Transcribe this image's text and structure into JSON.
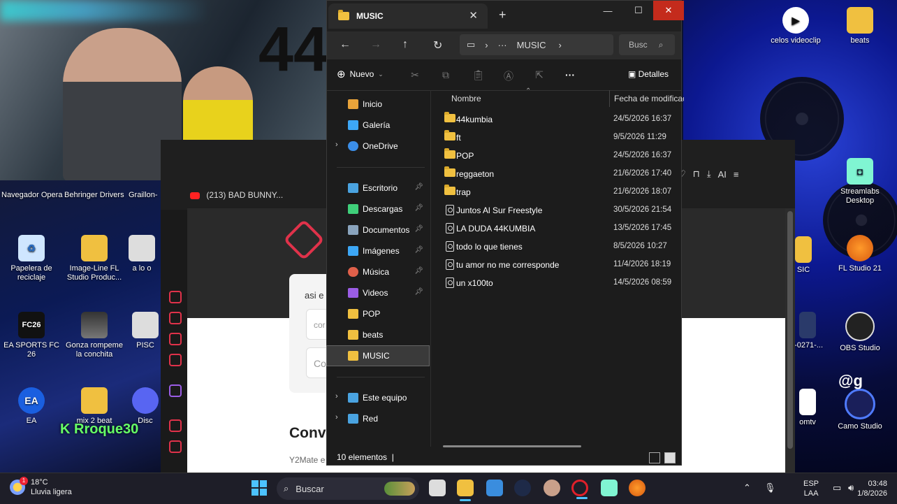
{
  "webcam": {
    "wall_text": "44"
  },
  "desktop": {
    "top_labels": [
      "Navegador Opera",
      "Behringer Drivers",
      "Graillon-"
    ],
    "left_icons": [
      {
        "label": "Papelera de reciclaje",
        "icon": "recycle-bin-icon"
      },
      {
        "label": "Image-Line FL Studio Produc...",
        "icon": "folder-icon"
      },
      {
        "label": "a lo o",
        "icon": "app-icon"
      },
      {
        "label": "EA SPORTS FC 26",
        "icon": "fc26-icon"
      },
      {
        "label": "Gonza rompeme la conchita",
        "icon": "video-icon"
      },
      {
        "label": "PISC",
        "icon": "app-icon"
      },
      {
        "label": "EA",
        "icon": "ea-icon"
      },
      {
        "label": "mix 2 beat",
        "icon": "folder-icon"
      },
      {
        "label": "Disc",
        "icon": "discord-icon"
      }
    ],
    "right_icons": [
      {
        "label": "celos videoclip",
        "icon": "video-icon"
      },
      {
        "label": "beats",
        "icon": "folder-icon"
      },
      {
        "label": "Streamlabs Desktop",
        "icon": "streamlabs-icon"
      },
      {
        "label": "SIC",
        "icon": "folder-icon"
      },
      {
        "label": "FL Studio 21",
        "icon": "fl-studio-icon"
      },
      {
        "label": "I-0271-...",
        "icon": "file-icon"
      },
      {
        "label": "OBS Studio",
        "icon": "obs-icon"
      },
      {
        "label": "omtv",
        "icon": "video-icon"
      },
      {
        "label": "Camo Studio",
        "icon": "camo-icon"
      }
    ],
    "overlay_text": "@g",
    "streamer_name": "Rroque30"
  },
  "browser": {
    "tab_title": "(213) BAD BUNNY...",
    "card_label": "asi e",
    "input1": "cor",
    "input2": "Co",
    "heading": "Conv",
    "footer_text": "Y2Mate e",
    "toolbar_ai": "AI"
  },
  "explorer": {
    "tab_title": "MUSIC",
    "breadcrumb_current": "MUSIC",
    "search_placeholder": "Busc",
    "new_button": "Nuevo",
    "details_button": "Detalles",
    "nav": [
      {
        "label": "Inicio",
        "icon": "home-icon",
        "color": "#e8a33a"
      },
      {
        "label": "Galería",
        "icon": "gallery-icon",
        "color": "#3da7f5"
      },
      {
        "label": "OneDrive",
        "icon": "onedrive-icon",
        "color": "#3b8ee8"
      },
      {
        "label": "Escritorio",
        "icon": "desktop-icon",
        "color": "#4aa3e0"
      },
      {
        "label": "Descargas",
        "icon": "download-icon",
        "color": "#3fcf7a"
      },
      {
        "label": "Documentos",
        "icon": "documents-icon",
        "color": "#8aa4bd"
      },
      {
        "label": "Imágenes",
        "icon": "pictures-icon",
        "color": "#3da7f5"
      },
      {
        "label": "Música",
        "icon": "music-icon",
        "color": "#e0604a"
      },
      {
        "label": "Videos",
        "icon": "videos-icon",
        "color": "#9b5de5"
      },
      {
        "label": "POP",
        "icon": "folder-icon",
        "color": "#f0c040"
      },
      {
        "label": "beats",
        "icon": "folder-icon",
        "color": "#f0c040"
      },
      {
        "label": "MUSIC",
        "icon": "folder-icon",
        "color": "#f0c040"
      },
      {
        "label": "Este equipo",
        "icon": "computer-icon",
        "color": "#4aa3e0"
      },
      {
        "label": "Red",
        "icon": "network-icon",
        "color": "#4aa3e0"
      }
    ],
    "columns": {
      "name": "Nombre",
      "date": "Fecha de modificac"
    },
    "files": [
      {
        "name": "44kumbia",
        "date": "24/5/2026 16:37",
        "type": "folder"
      },
      {
        "name": "ft",
        "date": "9/5/2026 11:29",
        "type": "folder"
      },
      {
        "name": "POP",
        "date": "24/5/2026 16:37",
        "type": "folder"
      },
      {
        "name": "reggaeton",
        "date": "21/6/2026 17:40",
        "type": "folder"
      },
      {
        "name": "trap",
        "date": "21/6/2026 18:07",
        "type": "folder"
      },
      {
        "name": "Juntos Al Sur Freestyle",
        "date": "30/5/2026 21:54",
        "type": "audio"
      },
      {
        "name": "LA DUDA 44KUMBIA",
        "date": "13/5/2026 17:45",
        "type": "audio"
      },
      {
        "name": "todo lo que tienes",
        "date": "8/5/2026 10:27",
        "type": "audio"
      },
      {
        "name": "tu amor no me corresponde",
        "date": "11/4/2026 18:19",
        "type": "audio"
      },
      {
        "name": "un x100to",
        "date": "14/5/2026 08:59",
        "type": "audio"
      }
    ],
    "status": "10 elementos"
  },
  "taskbar": {
    "weather_temp": "18°C",
    "weather_desc": "Lluvia ligera",
    "weather_badge": "1",
    "search_placeholder": "Buscar",
    "lang1": "ESP",
    "lang2": "LAA",
    "time": "03:48",
    "date": "1/8/2026"
  }
}
